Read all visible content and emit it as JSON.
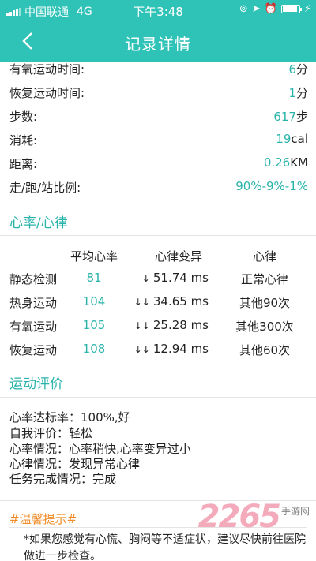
{
  "status_bar": {
    "carrier": "中国联通",
    "network": "4G",
    "time": "下午3:48",
    "battery_level": 0.9
  },
  "nav": {
    "title": "记录详情"
  },
  "stats": [
    {
      "label": "有氧运动时间:",
      "value": "6",
      "unit": "分"
    },
    {
      "label": "恢复运动时间:",
      "value": "1",
      "unit": "分"
    },
    {
      "label": "步数:",
      "value": "617",
      "unit": "步"
    },
    {
      "label": "消耗:",
      "value": "19",
      "unit": "cal"
    },
    {
      "label": "距离:",
      "value": "0.26",
      "unit": "KM"
    },
    {
      "label": "走/跑/站比例:",
      "value": "90%-9%-1%",
      "unit": ""
    }
  ],
  "heart": {
    "section_title": "心率/心律",
    "headers": [
      "平均心率",
      "心律变异",
      "心律"
    ],
    "rows": [
      {
        "name": "静态检测",
        "avg": "81",
        "arrows": "↓",
        "hrv": "51.74 ms",
        "rhythm": "正常心律"
      },
      {
        "name": "热身运动",
        "avg": "104",
        "arrows": "↓↓",
        "hrv": "34.65 ms",
        "rhythm": "其他90次"
      },
      {
        "name": "有氧运动",
        "avg": "105",
        "arrows": "↓↓",
        "hrv": "25.28 ms",
        "rhythm": "其他300次"
      },
      {
        "name": "恢复运动",
        "avg": "108",
        "arrows": "↓↓",
        "hrv": "12.94 ms",
        "rhythm": "其他60次"
      }
    ]
  },
  "evaluation": {
    "section_title": "运动评价",
    "lines": [
      "心率达标率：100%,好",
      "自我评价：轻松",
      "心率情况：心率稍快,心率变异过小",
      "心律情况：发现异常心律",
      "任务完成情况：完成"
    ]
  },
  "tips": {
    "title": "#温馨提示#",
    "text": "*如果您感觉有心慌、胸闷等不适症状，建议尽快前往医院做进一步检查。"
  },
  "watermark": {
    "logo": "2265",
    "site": "手游网"
  },
  "colors": {
    "teal": "#2fc2b6",
    "orange": "#f08a24"
  }
}
